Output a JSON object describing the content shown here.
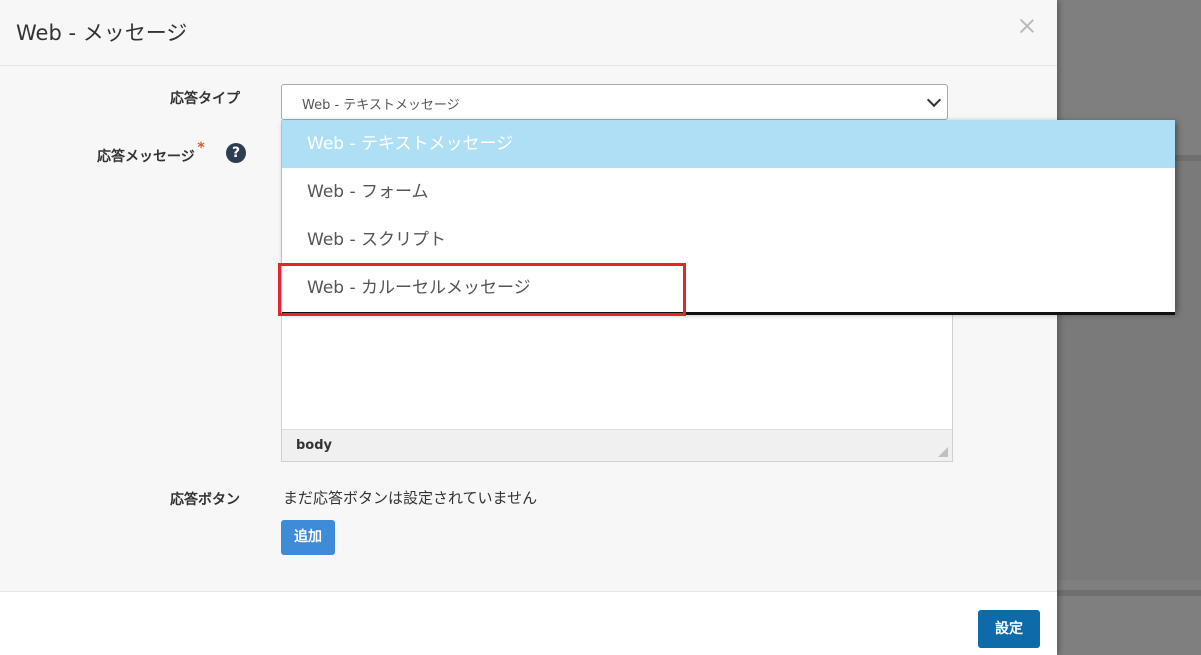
{
  "modal": {
    "title": "Web - メッセージ"
  },
  "form": {
    "response_type_label": "応答タイプ",
    "response_type_value": "Web - テキストメッセージ",
    "response_message_label": "応答メッセージ",
    "required_mark": "*",
    "help_glyph": "?",
    "editor_path": "body",
    "response_button_label": "応答ボタン",
    "no_buttons_text": "まだ応答ボタンは設定されていません",
    "add_button": "追加"
  },
  "dropdown": {
    "options": [
      {
        "label": "Web - テキストメッセージ",
        "selected": true
      },
      {
        "label": "Web - フォーム",
        "selected": false
      },
      {
        "label": "Web - スクリプト",
        "selected": false
      },
      {
        "label": "Web - カルーセルメッセージ",
        "selected": false,
        "highlighted": true
      }
    ]
  },
  "footer": {
    "submit_button": "設定"
  },
  "colors": {
    "selected_option_bg": "#aedff5",
    "highlight_border": "#e3262e",
    "add_button_bg": "#3d8bd9",
    "submit_button_bg": "#0e6aa8",
    "required_mark": "#e8542a"
  },
  "icons": [
    "close-icon",
    "help-icon",
    "chevron-down-icon",
    "resize-icon"
  ]
}
